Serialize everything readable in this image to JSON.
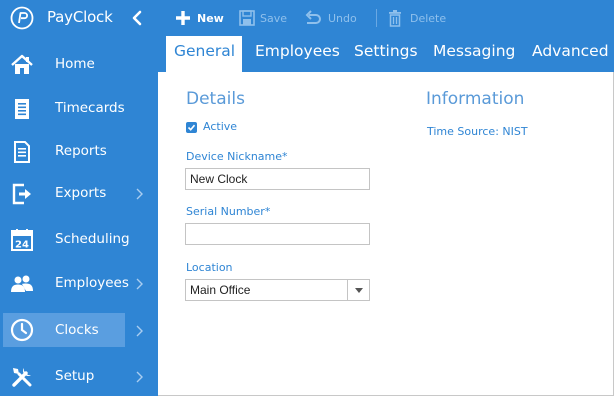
{
  "brand": {
    "name": "PayClock"
  },
  "sidebar": {
    "items": [
      {
        "label": "Home",
        "icon": "home-icon",
        "has_submenu": false
      },
      {
        "label": "Timecards",
        "icon": "timecard-icon",
        "has_submenu": false
      },
      {
        "label": "Reports",
        "icon": "report-icon",
        "has_submenu": false
      },
      {
        "label": "Exports",
        "icon": "export-icon",
        "has_submenu": true
      },
      {
        "label": "Scheduling",
        "icon": "calendar-icon",
        "calendar_day": "24",
        "has_submenu": false
      },
      {
        "label": "Employees",
        "icon": "users-icon",
        "has_submenu": true
      },
      {
        "label": "Clocks",
        "icon": "clock-icon",
        "has_submenu": true,
        "active": true
      },
      {
        "label": "Setup",
        "icon": "tools-icon",
        "has_submenu": true
      }
    ]
  },
  "toolbar": {
    "new_label": "New",
    "save_label": "Save",
    "undo_label": "Undo",
    "delete_label": "Delete"
  },
  "tabs": [
    {
      "label": "General",
      "active": true
    },
    {
      "label": "Employees",
      "active": false
    },
    {
      "label": "Settings",
      "active": false
    },
    {
      "label": "Messaging",
      "active": false
    },
    {
      "label": "Advanced",
      "active": false
    }
  ],
  "details": {
    "title": "Details",
    "active_label": "Active",
    "active_checked": true,
    "nickname_label": "Device Nickname",
    "nickname_value": "New Clock",
    "serial_label": "Serial Number",
    "serial_value": "",
    "required_mark": "*",
    "location_label": "Location",
    "location_value": "Main Office"
  },
  "information": {
    "title": "Information",
    "time_source": "Time Source: NIST"
  },
  "colors": {
    "primary": "#2f85d4",
    "active_nav": "#5a9ee0",
    "section_title": "#5a9ad8",
    "disabled_toolbar": "#8fc0ec"
  }
}
